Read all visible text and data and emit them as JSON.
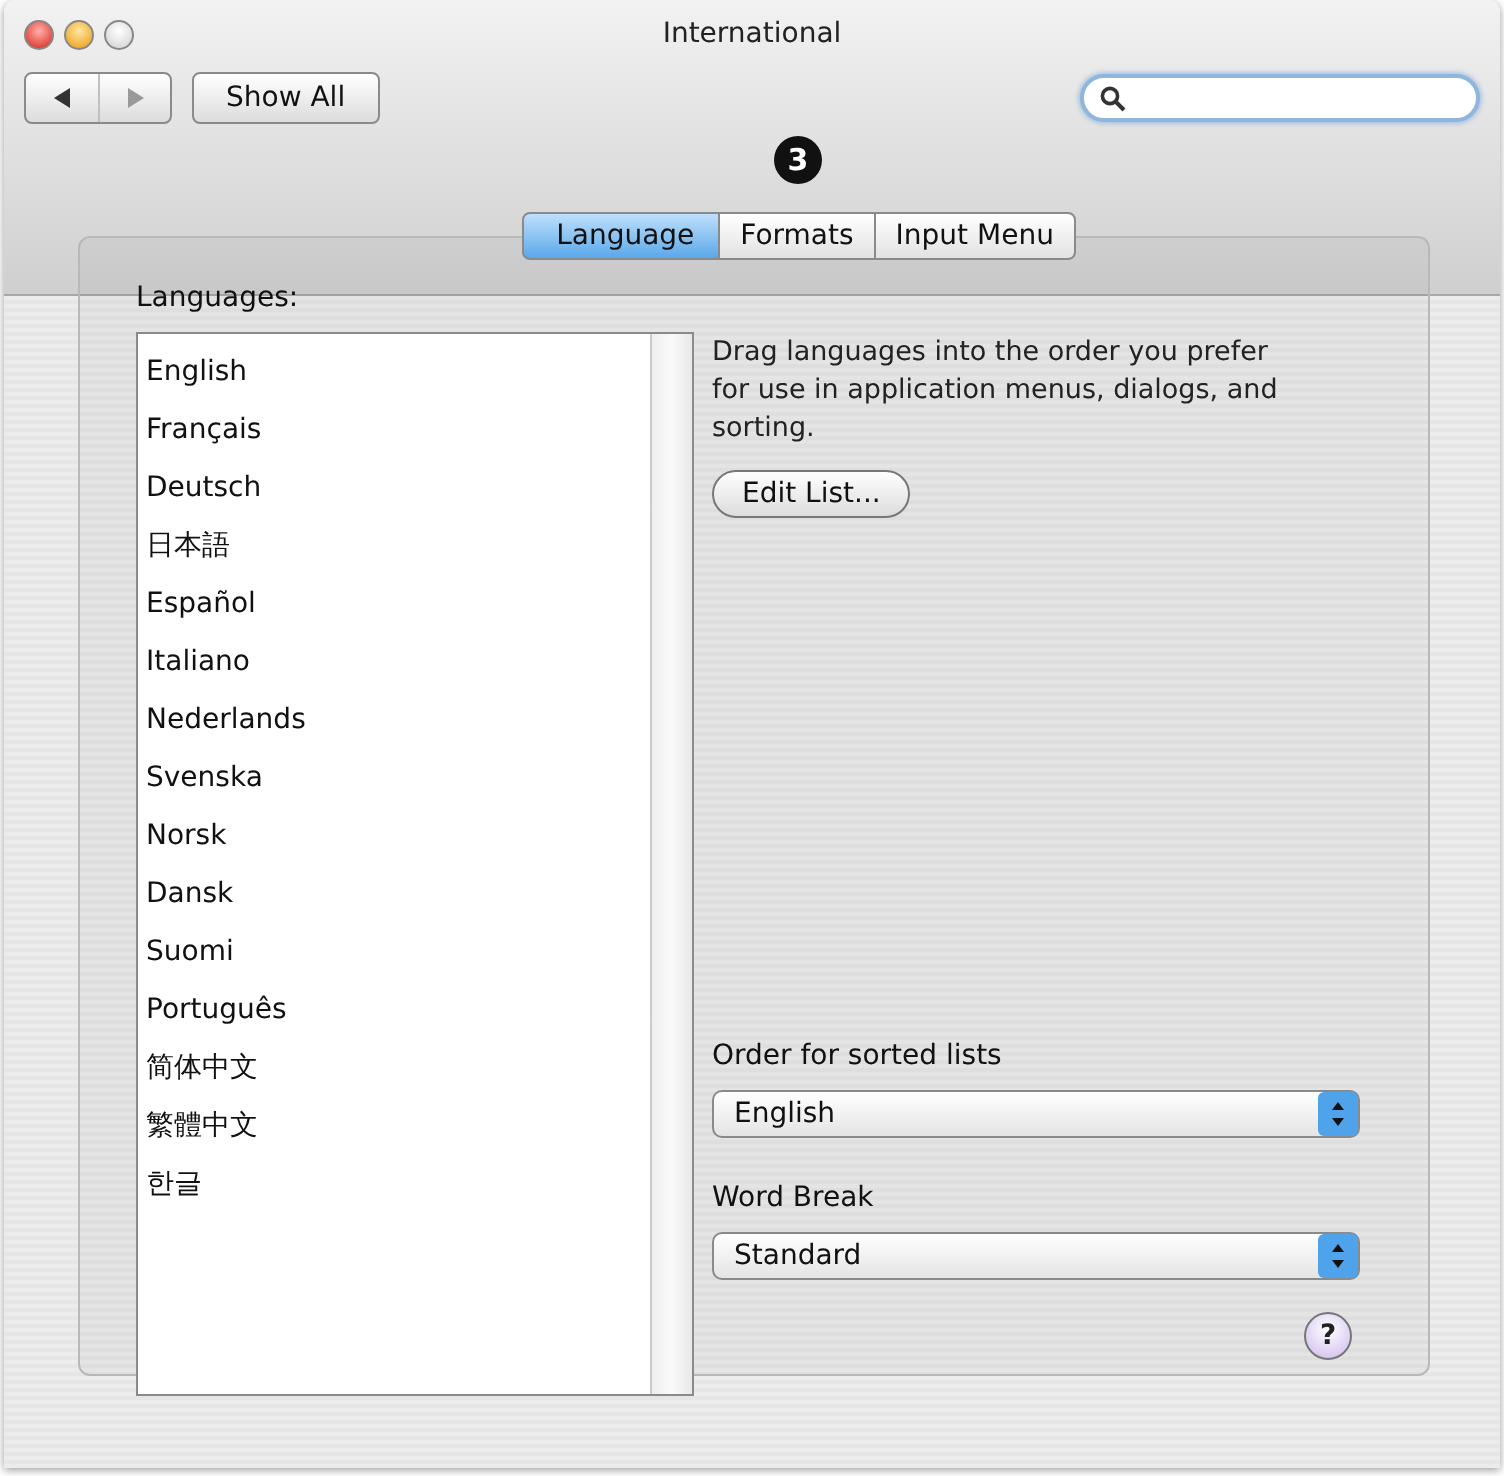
{
  "window": {
    "title": "International",
    "traffic_lights": [
      {
        "kind": "close",
        "enabled": true
      },
      {
        "kind": "minimize",
        "enabled": true
      },
      {
        "kind": "zoom",
        "enabled": false
      }
    ]
  },
  "toolbar": {
    "show_all": "Show All"
  },
  "callout": "3",
  "tabs": [
    {
      "label": "Language",
      "selected": true
    },
    {
      "label": "Formats",
      "selected": false
    },
    {
      "label": "Input Menu",
      "selected": false
    }
  ],
  "languages_label": "Languages:",
  "languages": [
    "English",
    "Français",
    "Deutsch",
    "日本語",
    "Español",
    "Italiano",
    "Nederlands",
    "Svenska",
    "Norsk",
    "Dansk",
    "Suomi",
    "Português",
    "简体中文",
    "繁體中文",
    "한글"
  ],
  "description": "Drag languages into the order you prefer for use in application menus, dialogs, and sorting.",
  "edit_list": "Edit List...",
  "popups": [
    {
      "label": "Order for sorted lists",
      "value": "English"
    },
    {
      "label": "Word Break",
      "value": "Standard"
    }
  ],
  "help": "?"
}
